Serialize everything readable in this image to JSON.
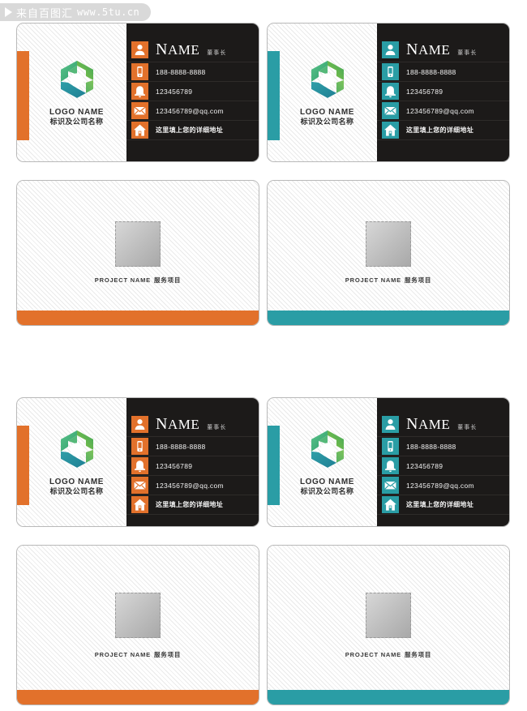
{
  "watermark": {
    "play_icon": "play-triangle-icon",
    "source_cn": "来自百图汇",
    "url": "www.5tu.cn"
  },
  "colors": {
    "orange": "#e2712b",
    "teal": "#2a9da5",
    "dark_panel": "#1c1a19",
    "card_bg": "#fbfbfb",
    "border": "#b9b9b9",
    "text_light": "#f2f2f2",
    "text_dark": "#2f2f2f"
  },
  "card_front": {
    "logo": {
      "mark_icon": "hexagon-swirl-logo-icon",
      "name": "LOGO NAME",
      "name_cn": "标识及公司名称"
    },
    "name_row": {
      "icon": "person-icon",
      "name_initial": "N",
      "name_rest": "AME",
      "title_cn": "董事长"
    },
    "rows": [
      {
        "icon": "mobile-phone-icon",
        "text": "188-8888-8888",
        "is_cn": false
      },
      {
        "icon": "telephone-bell-icon",
        "text": "123456789",
        "is_cn": false
      },
      {
        "icon": "envelope-icon",
        "text": "123456789@qq.com",
        "is_cn": false
      },
      {
        "icon": "home-icon",
        "text": "这里填上您的详细地址",
        "is_cn": true
      }
    ]
  },
  "card_back": {
    "placeholder_icon": "image-placeholder-icon",
    "project_label": "PROJECT NAME",
    "project_label_cn": "服务项目"
  },
  "sets": [
    {
      "id": "set-0",
      "variant": "orange",
      "size": "standard"
    },
    {
      "id": "set-1",
      "variant": "teal",
      "size": "standard"
    },
    {
      "id": "set-2",
      "variant": "orange",
      "size": "tall"
    },
    {
      "id": "set-3",
      "variant": "teal",
      "size": "tall"
    }
  ]
}
